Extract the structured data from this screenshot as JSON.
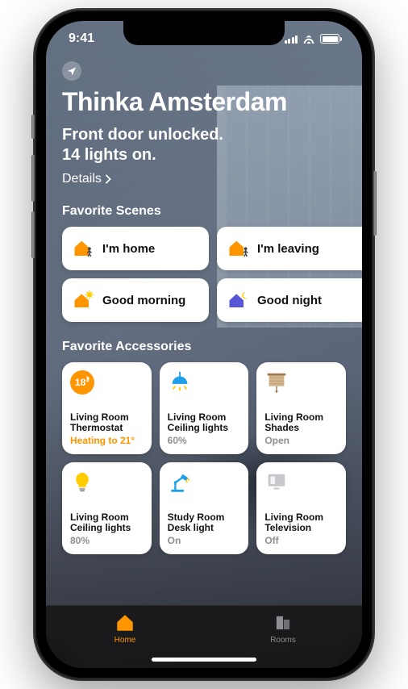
{
  "status_bar": {
    "time": "9:41"
  },
  "header": {
    "home_name": "Thinka Amsterdam",
    "status_line_1": "Front door unlocked.",
    "status_line_2": "14 lights on.",
    "details_label": "Details"
  },
  "sections": {
    "scenes_title": "Favorite Scenes",
    "accessories_title": "Favorite Accessories"
  },
  "scenes": [
    {
      "label": "I'm home"
    },
    {
      "label": "I'm leaving"
    },
    {
      "label": "Good morning"
    },
    {
      "label": "Good night"
    }
  ],
  "accessories": [
    {
      "room": "Living Room",
      "name": "Thermostat",
      "status": "Heating to 21°",
      "status_color": "orange",
      "temp": "18°",
      "icon": "thermostat"
    },
    {
      "room": "Living Room",
      "name": "Ceiling lights",
      "status": "60%",
      "status_color": "gray",
      "icon": "ceiling-light-on"
    },
    {
      "room": "Living Room",
      "name": "Shades",
      "status": "Open",
      "status_color": "gray",
      "icon": "shades"
    },
    {
      "room": "Living Room",
      "name": "Ceiling lights",
      "status": "80%",
      "status_color": "gray",
      "icon": "bulb"
    },
    {
      "room": "Study Room",
      "name": "Desk light",
      "status": "On",
      "status_color": "gray",
      "icon": "desk-lamp"
    },
    {
      "room": "Living Room",
      "name": "Television",
      "status": "Off",
      "status_color": "gray",
      "icon": "television"
    }
  ],
  "tabs": {
    "home": "Home",
    "rooms": "Rooms"
  },
  "colors": {
    "accent": "#ff9500",
    "blue": "#1e9fe8",
    "indigo": "#5856d6",
    "gray": "#8e8e93"
  }
}
